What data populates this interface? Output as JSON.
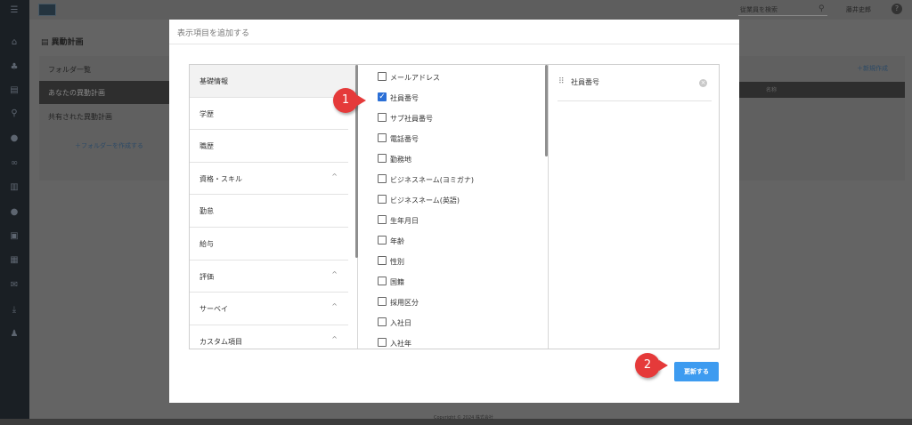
{
  "header": {
    "search_placeholder": "従業員を検索",
    "user_name": "藤井史郎"
  },
  "page": {
    "title": "異動計画",
    "folder_list": "フォルダ一覧",
    "my_plans": "あなたの異動計画",
    "shared_plans": "共有された異動計画",
    "create_folder": "＋フォルダーを作成する",
    "new_button": "＋新規作成",
    "table_head": "名称",
    "copyright": "Copyright © 2024 株式会社"
  },
  "modal": {
    "title": "表示項目を追加する",
    "categories": [
      {
        "label": "基礎情報",
        "active": true,
        "chevron": false
      },
      {
        "label": "学歴",
        "active": false,
        "chevron": false
      },
      {
        "label": "職歴",
        "active": false,
        "chevron": false
      },
      {
        "label": "資格・スキル",
        "active": false,
        "chevron": true
      },
      {
        "label": "勤怠",
        "active": false,
        "chevron": false
      },
      {
        "label": "給与",
        "active": false,
        "chevron": false
      },
      {
        "label": "評価",
        "active": false,
        "chevron": true
      },
      {
        "label": "サーベイ",
        "active": false,
        "chevron": true
      },
      {
        "label": "カスタム項目",
        "active": false,
        "chevron": true
      }
    ],
    "fields": [
      {
        "label": "メールアドレス",
        "checked": false
      },
      {
        "label": "社員番号",
        "checked": true
      },
      {
        "label": "サブ社員番号",
        "checked": false
      },
      {
        "label": "電話番号",
        "checked": false
      },
      {
        "label": "勤務地",
        "checked": false
      },
      {
        "label": "ビジネスネーム(ヨミガナ)",
        "checked": false
      },
      {
        "label": "ビジネスネーム(英語)",
        "checked": false
      },
      {
        "label": "生年月日",
        "checked": false
      },
      {
        "label": "年齢",
        "checked": false
      },
      {
        "label": "性別",
        "checked": false
      },
      {
        "label": "国籍",
        "checked": false
      },
      {
        "label": "採用区分",
        "checked": false
      },
      {
        "label": "入社日",
        "checked": false
      },
      {
        "label": "入社年",
        "checked": false
      }
    ],
    "selected": [
      "社員番号"
    ],
    "update_label": "更新する",
    "chevron_glyph": "^",
    "check_glyph": "✓",
    "remove_glyph": "×",
    "grip_glyph": "⠿"
  },
  "annotations": {
    "step1": "1",
    "step2": "2",
    "color": "#e53a3a"
  }
}
